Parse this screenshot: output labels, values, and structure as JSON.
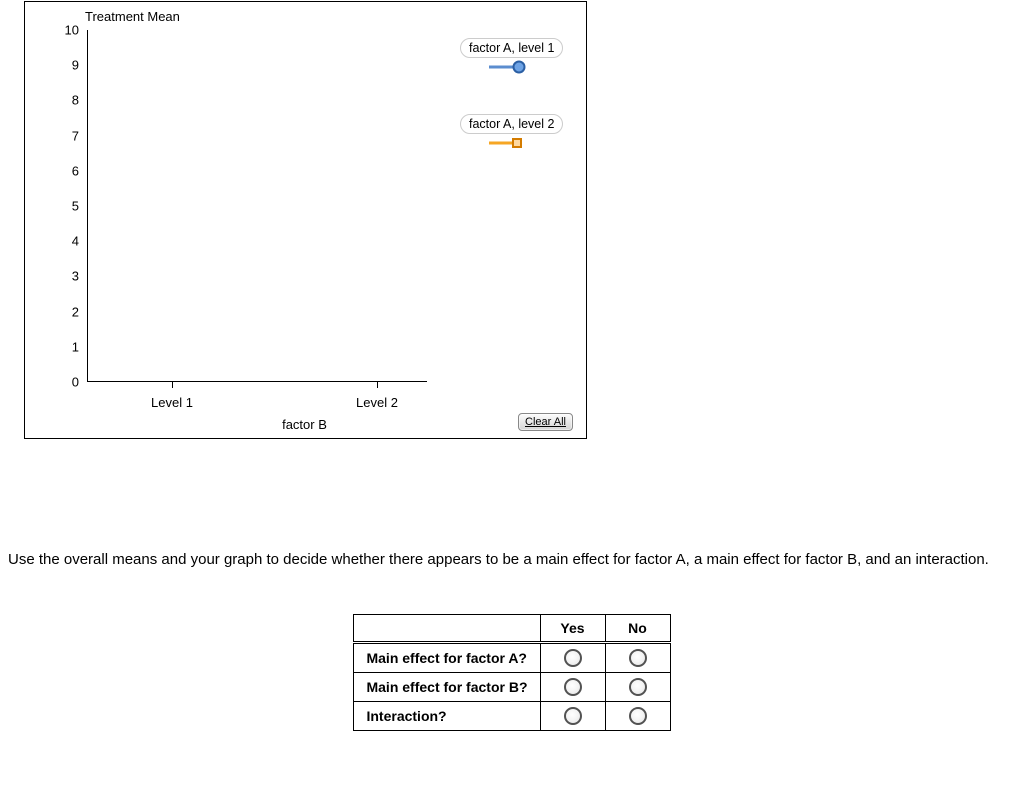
{
  "chart_data": {
    "type": "line",
    "title": "Treatment Mean",
    "xlabel": "factor B",
    "ylabel": "",
    "ylim": [
      0,
      10
    ],
    "y_ticks": [
      0,
      1,
      2,
      3,
      4,
      5,
      6,
      7,
      8,
      9,
      10
    ],
    "categories": [
      "Level 1",
      "Level 2"
    ],
    "series": [
      {
        "name": "factor A, level 1",
        "color": "#5b8dcf",
        "marker": "circle",
        "values": [
          null,
          null
        ]
      },
      {
        "name": "factor A, level 2",
        "color": "#f6a623",
        "marker": "square",
        "values": [
          null,
          null
        ]
      }
    ]
  },
  "clear_button_label": "Clear All",
  "legend": {
    "item1_label": "factor A, level 1",
    "item2_label": "factor A, level 2"
  },
  "instructions_text": "Use the overall means and your graph to decide whether there appears to be a main effect for factor A, a main effect for factor B, and an interaction.",
  "table": {
    "col_yes": "Yes",
    "col_no": "No",
    "rows": [
      {
        "label": "Main effect for factor A?"
      },
      {
        "label": "Main effect for factor B?"
      },
      {
        "label": "Interaction?"
      }
    ]
  },
  "axis": {
    "x_tick_0": "Level 1",
    "x_tick_1": "Level 2",
    "x_label": "factor B",
    "y_tick_0": "0",
    "y_tick_1": "1",
    "y_tick_2": "2",
    "y_tick_3": "3",
    "y_tick_4": "4",
    "y_tick_5": "5",
    "y_tick_6": "6",
    "y_tick_7": "7",
    "y_tick_8": "8",
    "y_tick_9": "9",
    "y_tick_10": "10"
  }
}
